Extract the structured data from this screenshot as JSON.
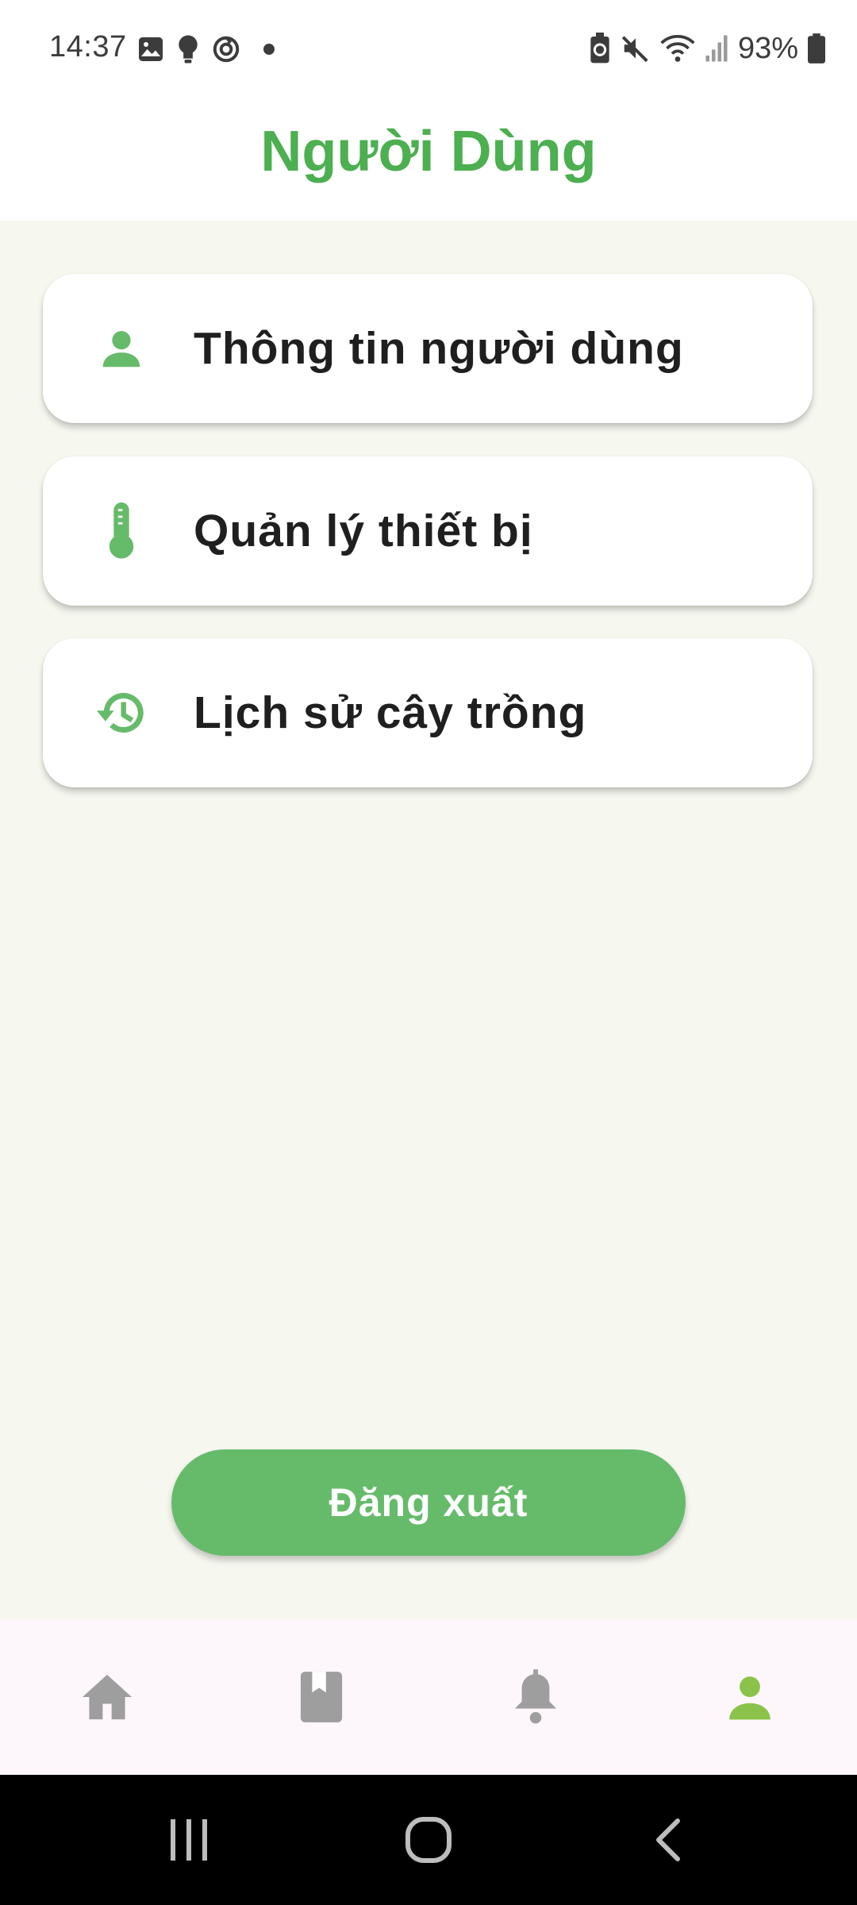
{
  "status_bar": {
    "time": "14:37",
    "battery": "93%",
    "left_icons": [
      "image-icon",
      "bulb-icon",
      "sync-icon",
      "dot-icon"
    ],
    "right_icons": [
      "battery-saver-icon",
      "mute-icon",
      "wifi-icon",
      "signal-icon",
      "battery-icon"
    ]
  },
  "header": {
    "title": "Người Dùng"
  },
  "menu": {
    "items": [
      {
        "label": "Thông tin người dùng",
        "icon": "person-icon"
      },
      {
        "label": "Quản lý thiết bị",
        "icon": "thermometer-icon"
      },
      {
        "label": "Lịch sử cây trồng",
        "icon": "history-icon"
      }
    ]
  },
  "logout": {
    "label": "Đăng xuất"
  },
  "bottom_nav": {
    "items": [
      {
        "name": "home",
        "icon": "home-icon",
        "active": false
      },
      {
        "name": "book",
        "icon": "book-icon",
        "active": false
      },
      {
        "name": "notifications",
        "icon": "bell-icon",
        "active": false
      },
      {
        "name": "user",
        "icon": "person-icon",
        "active": true
      }
    ]
  },
  "colors": {
    "accent": "#4caf50",
    "button": "#66bb6a",
    "icon_active": "#8bc34a",
    "icon_inactive": "#9e9e9e",
    "background": "#f6f7ef"
  }
}
